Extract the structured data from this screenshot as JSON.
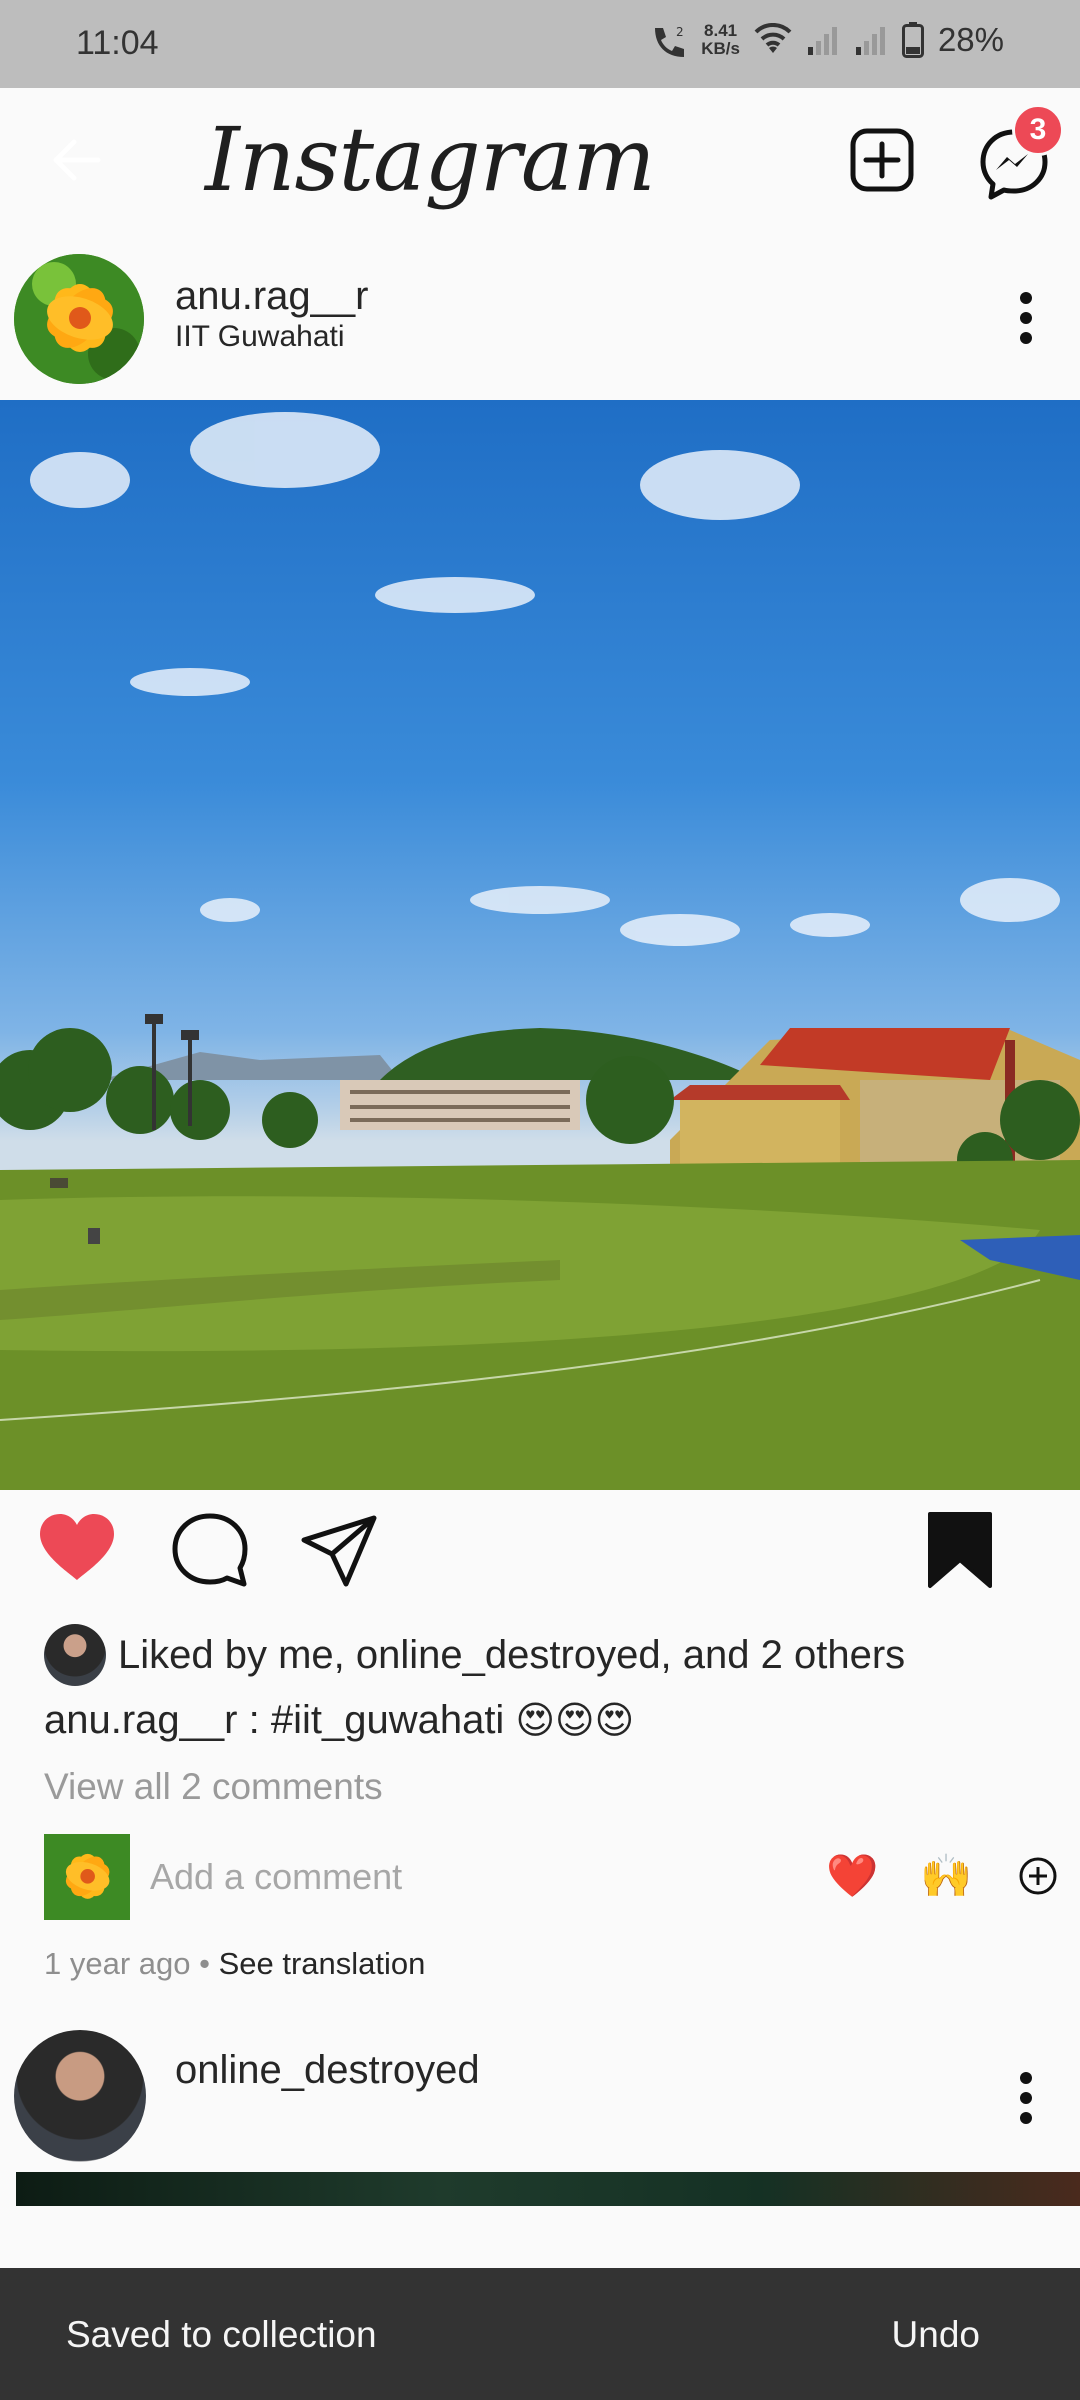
{
  "status_bar": {
    "time": "11:04",
    "speed_value": "8.41",
    "speed_unit": "KB/s",
    "battery": "28%"
  },
  "header": {
    "logo": "Instagram",
    "messages_badge": "3"
  },
  "post": {
    "username": "anu.rag__r",
    "location": "IIT Guwahati",
    "liked_by": "Liked by me, online_destroyed, and 2 others",
    "caption_user": "anu.rag__r",
    "caption_text": " : #iit_guwahati ",
    "caption_emojis": "😍😍😍",
    "view_all_comments": "View all 2 comments",
    "comment_placeholder": "Add a comment",
    "reaction_1": "❤️",
    "reaction_2": "🙌",
    "time_ago": "1 year ago",
    "separator": " • ",
    "see_translation": "See translation",
    "liked": true,
    "saved": true
  },
  "next_post": {
    "username": "online_destroyed"
  },
  "snackbar": {
    "message": "Saved to collection",
    "action": "Undo"
  },
  "colors": {
    "like_red": "#ed4956",
    "snackbar_bg": "#333333"
  }
}
